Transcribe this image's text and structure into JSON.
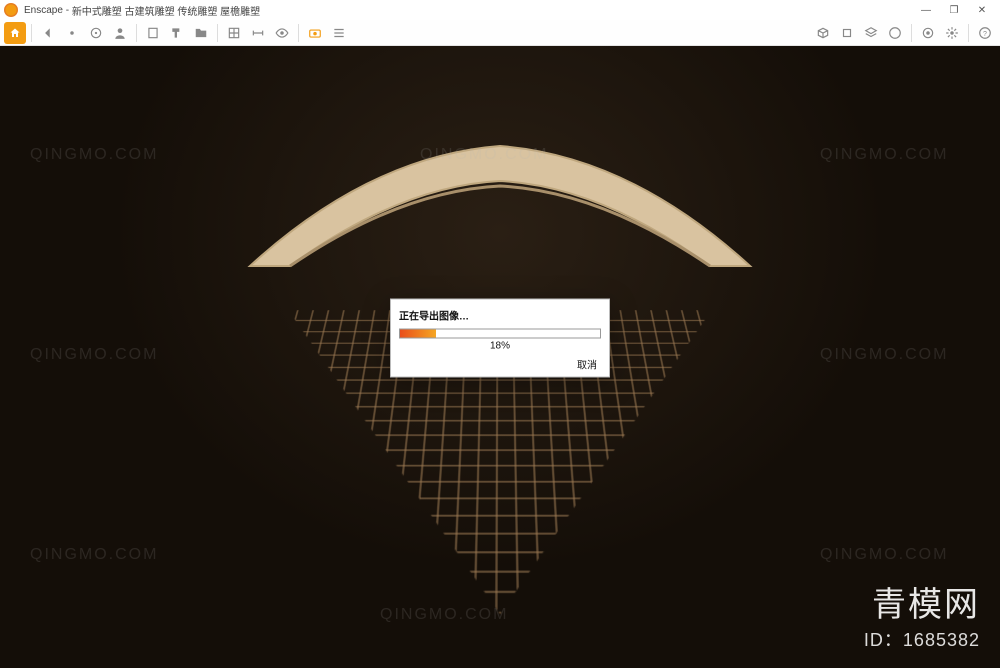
{
  "titlebar": {
    "app_name": "Enscape",
    "document": "新中式雕塑 古建筑雕塑 传统雕塑 屋檐雕塑",
    "minimize": "—",
    "maximize": "❐",
    "close": "✕"
  },
  "toolbar": {
    "home_icon": "home-icon",
    "icons_left": [
      "nav-back-icon",
      "bullet-icon",
      "target-icon",
      "person-icon",
      "building-icon",
      "paint-icon",
      "folder-icon",
      "plan-icon",
      "dimension-icon",
      "view-icon",
      "snapshot-icon",
      "menu-icon"
    ],
    "icons_right": [
      "package-icon",
      "cube-icon",
      "layers-icon",
      "palette-icon",
      "material-icon",
      "settings-gear-icon",
      "help-icon"
    ]
  },
  "dialog": {
    "title": "正在导出图像…",
    "percent_text": "18%",
    "percent_value": 18,
    "cancel": "取消"
  },
  "watermark_text": "QINGMO.COM",
  "brand": {
    "name": "青模网",
    "id": "ID：1685382"
  },
  "colors": {
    "accent": "#f39c12",
    "progress_start": "#e94e1b",
    "progress_end": "#f5a623",
    "viewport_bg": "#140e08"
  }
}
